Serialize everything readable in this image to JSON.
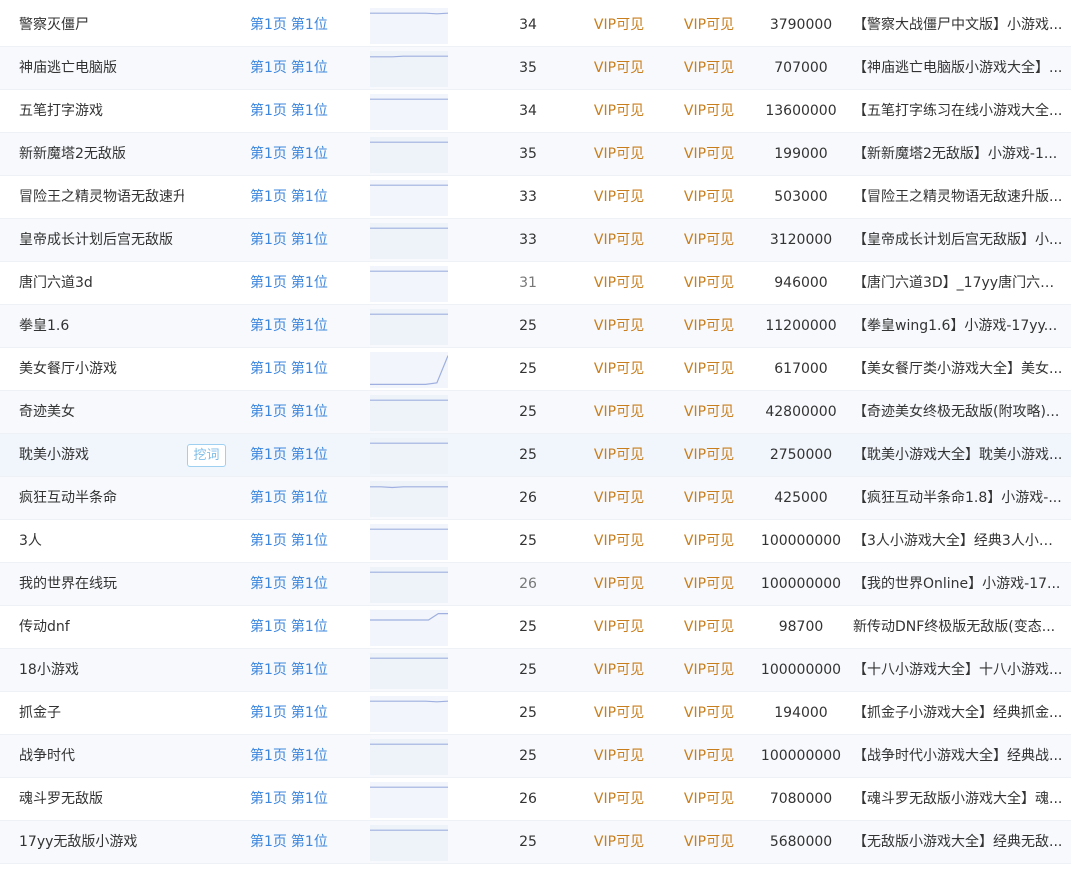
{
  "dig_label": "挖词",
  "rows": [
    {
      "keyword": "警察灭僵尸",
      "rank_page": "第1页",
      "rank_pos": "第1位",
      "index": "34",
      "vip_a": "VIP可见",
      "vip_b": "VIP可见",
      "results": "3790000",
      "title": "【警察大战僵尸中文版】小游戏...",
      "trend": [
        0.1,
        0.1,
        0.1,
        0.1,
        0.1,
        0.1,
        0.12,
        0.1
      ]
    },
    {
      "keyword": "神庙逃亡电脑版",
      "rank_page": "第1页",
      "rank_pos": "第1位",
      "index": "35",
      "vip_a": "VIP可见",
      "vip_b": "VIP可见",
      "results": "707000",
      "title": "【神庙逃亡电脑版小游戏大全】...",
      "trend": [
        0.12,
        0.12,
        0.12,
        0.1,
        0.1,
        0.1,
        0.1,
        0.1
      ]
    },
    {
      "keyword": "五笔打字游戏",
      "rank_page": "第1页",
      "rank_pos": "第1位",
      "index": "34",
      "vip_a": "VIP可见",
      "vip_b": "VIP可见",
      "results": "13600000",
      "title": "【五笔打字练习在线小游戏大全...",
      "trend": [
        0.1,
        0.1,
        0.1,
        0.1,
        0.1,
        0.1,
        0.1,
        0.1
      ]
    },
    {
      "keyword": "新新魔塔2无敌版",
      "rank_page": "第1页",
      "rank_pos": "第1位",
      "index": "35",
      "vip_a": "VIP可见",
      "vip_b": "VIP可见",
      "results": "199000",
      "title": "【新新魔塔2无敌版】小游戏-1...",
      "trend": [
        0.1,
        0.1,
        0.1,
        0.1,
        0.1,
        0.1,
        0.1,
        0.1
      ]
    },
    {
      "keyword": "冒险王之精灵物语无敌速升版",
      "rank_page": "第1页",
      "rank_pos": "第1位",
      "index": "33",
      "vip_a": "VIP可见",
      "vip_b": "VIP可见",
      "results": "503000",
      "title": "【冒险王之精灵物语无敌速升版...",
      "trend": [
        0.1,
        0.1,
        0.1,
        0.1,
        0.1,
        0.1,
        0.1,
        0.1
      ]
    },
    {
      "keyword": "皇帝成长计划后宫无敌版",
      "rank_page": "第1页",
      "rank_pos": "第1位",
      "index": "33",
      "vip_a": "VIP可见",
      "vip_b": "VIP可见",
      "results": "3120000",
      "title": "【皇帝成长计划后宫无敌版】小...",
      "trend": [
        0.1,
        0.1,
        0.1,
        0.1,
        0.1,
        0.1,
        0.1,
        0.1
      ]
    },
    {
      "keyword": "唐门六道3d",
      "rank_page": "第1页",
      "rank_pos": "第1位",
      "index": "31",
      "index_dim": true,
      "vip_a": "VIP可见",
      "vip_b": "VIP可见",
      "results": "946000",
      "title": "【唐门六道3D】_17yy唐门六道...",
      "trend": [
        0.1,
        0.1,
        0.1,
        0.1,
        0.1,
        0.1,
        0.1,
        0.1
      ]
    },
    {
      "keyword": "拳皇1.6",
      "rank_page": "第1页",
      "rank_pos": "第1位",
      "index": "25",
      "vip_a": "VIP可见",
      "vip_b": "VIP可见",
      "results": "11200000",
      "title": "【拳皇wing1.6】小游戏-17yy...",
      "trend": [
        0.1,
        0.1,
        0.1,
        0.1,
        0.1,
        0.1,
        0.1,
        0.1
      ]
    },
    {
      "keyword": "美女餐厅小游戏",
      "rank_page": "第1页",
      "rank_pos": "第1位",
      "index": "25",
      "vip_a": "VIP可见",
      "vip_b": "VIP可见",
      "results": "617000",
      "title": "【美女餐厅类小游戏大全】美女...",
      "trend": [
        0.95,
        0.95,
        0.95,
        0.95,
        0.95,
        0.95,
        0.9,
        0.05
      ]
    },
    {
      "keyword": "奇迹美女",
      "rank_page": "第1页",
      "rank_pos": "第1位",
      "index": "25",
      "vip_a": "VIP可见",
      "vip_b": "VIP可见",
      "results": "42800000",
      "title": "【奇迹美女终极无敌版(附攻略)...",
      "trend": [
        0.1,
        0.1,
        0.1,
        0.1,
        0.1,
        0.1,
        0.1,
        0.1
      ]
    },
    {
      "keyword": "耽美小游戏",
      "rank_page": "第1页",
      "rank_pos": "第1位",
      "index": "25",
      "vip_a": "VIP可见",
      "vip_b": "VIP可见",
      "results": "2750000",
      "title": "【耽美小游戏大全】耽美小游戏...",
      "trend": [
        0.1,
        0.1,
        0.1,
        0.1,
        0.1,
        0.1,
        0.1,
        0.1
      ],
      "hover": true,
      "show_dig": true
    },
    {
      "keyword": "疯狂互动半条命",
      "rank_page": "第1页",
      "rank_pos": "第1位",
      "index": "26",
      "vip_a": "VIP可见",
      "vip_b": "VIP可见",
      "results": "425000",
      "title": "【疯狂互动半条命1.8】小游戏-...",
      "trend": [
        0.12,
        0.12,
        0.14,
        0.12,
        0.12,
        0.12,
        0.12,
        0.12
      ]
    },
    {
      "keyword": "3人",
      "rank_page": "第1页",
      "rank_pos": "第1位",
      "index": "25",
      "vip_a": "VIP可见",
      "vip_b": "VIP可见",
      "results": "100000000",
      "title": "【3人小游戏大全】经典3人小游...",
      "trend": [
        0.1,
        0.1,
        0.1,
        0.1,
        0.1,
        0.1,
        0.1,
        0.1
      ]
    },
    {
      "keyword": "我的世界在线玩",
      "rank_page": "第1页",
      "rank_pos": "第1位",
      "index": "26",
      "index_dim": true,
      "vip_a": "VIP可见",
      "vip_b": "VIP可见",
      "results": "100000000",
      "title": "【我的世界Online】小游戏-17...",
      "trend": [
        0.1,
        0.1,
        0.1,
        0.1,
        0.1,
        0.1,
        0.1,
        0.1
      ]
    },
    {
      "keyword": "传动dnf",
      "rank_page": "第1页",
      "rank_pos": "第1位",
      "index": "25",
      "vip_a": "VIP可见",
      "vip_b": "VIP可见",
      "results": "98700",
      "title": "新传动DNF终极版无敌版(变态...",
      "trend": [
        0.25,
        0.25,
        0.25,
        0.25,
        0.25,
        0.25,
        0.25,
        0.05,
        0.05
      ]
    },
    {
      "keyword": "18小游戏",
      "rank_page": "第1页",
      "rank_pos": "第1位",
      "index": "25",
      "vip_a": "VIP可见",
      "vip_b": "VIP可见",
      "results": "100000000",
      "title": "【十八小游戏大全】十八小游戏...",
      "trend": [
        0.1,
        0.1,
        0.1,
        0.1,
        0.1,
        0.1,
        0.1,
        0.1
      ]
    },
    {
      "keyword": "抓金子",
      "rank_page": "第1页",
      "rank_pos": "第1位",
      "index": "25",
      "vip_a": "VIP可见",
      "vip_b": "VIP可见",
      "results": "194000",
      "title": "【抓金子小游戏大全】经典抓金...",
      "trend": [
        0.1,
        0.1,
        0.1,
        0.1,
        0.1,
        0.1,
        0.12,
        0.1
      ]
    },
    {
      "keyword": "战争时代",
      "rank_page": "第1页",
      "rank_pos": "第1位",
      "index": "25",
      "vip_a": "VIP可见",
      "vip_b": "VIP可见",
      "results": "100000000",
      "title": "【战争时代小游戏大全】经典战...",
      "trend": [
        0.1,
        0.1,
        0.1,
        0.1,
        0.1,
        0.1,
        0.1,
        0.1
      ]
    },
    {
      "keyword": "魂斗罗无敌版",
      "rank_page": "第1页",
      "rank_pos": "第1位",
      "index": "26",
      "vip_a": "VIP可见",
      "vip_b": "VIP可见",
      "results": "7080000",
      "title": "【魂斗罗无敌版小游戏大全】魂...",
      "trend": [
        0.1,
        0.1,
        0.1,
        0.1,
        0.1,
        0.1,
        0.1,
        0.1
      ]
    },
    {
      "keyword": "17yy无敌版小游戏",
      "rank_page": "第1页",
      "rank_pos": "第1位",
      "index": "25",
      "vip_a": "VIP可见",
      "vip_b": "VIP可见",
      "results": "5680000",
      "title": "【无敌版小游戏大全】经典无敌...",
      "trend": [
        0.1,
        0.1,
        0.1,
        0.1,
        0.1,
        0.1,
        0.1,
        0.1
      ]
    }
  ]
}
